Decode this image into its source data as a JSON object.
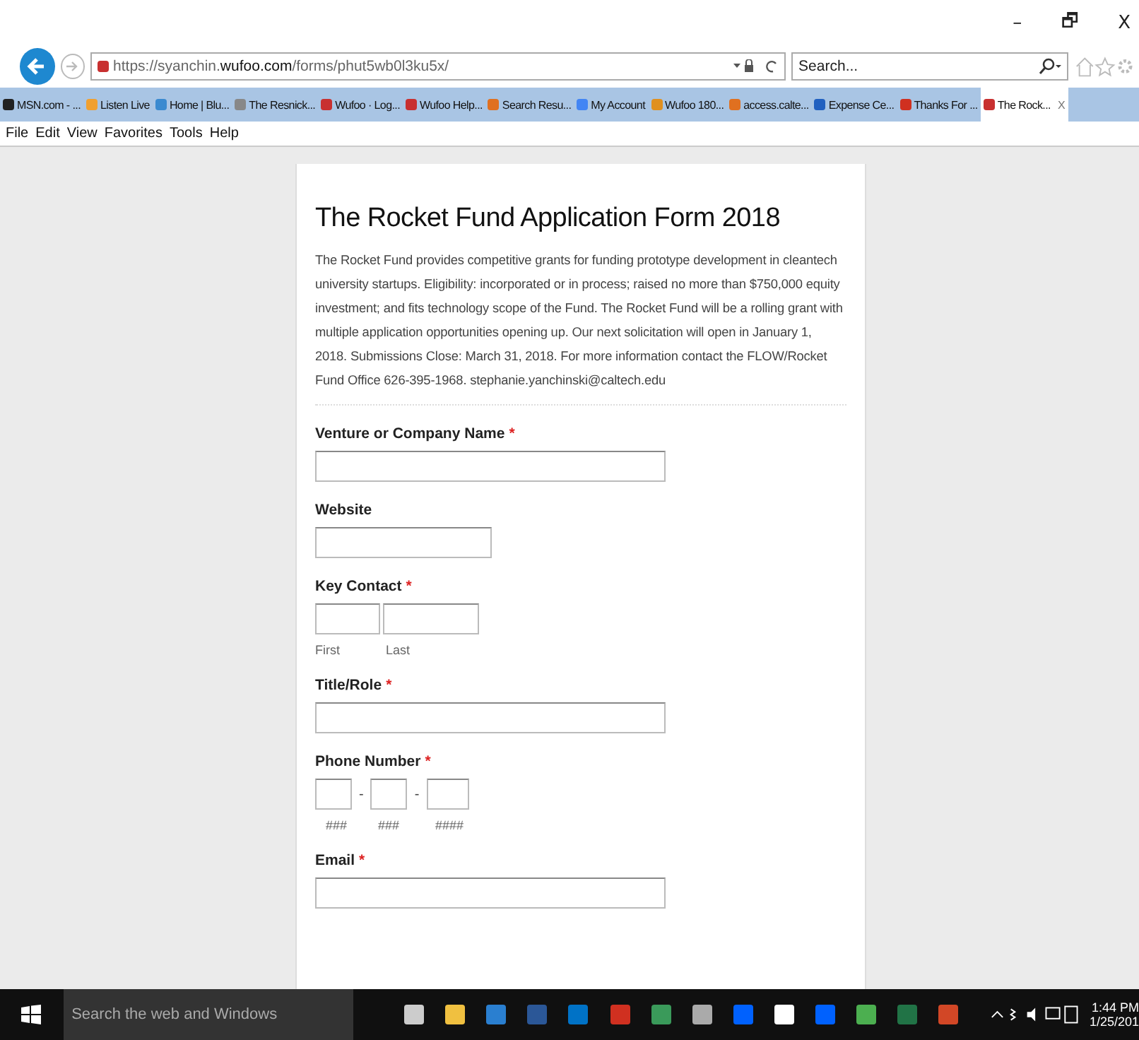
{
  "window": {
    "controls": [
      "–",
      "🗗",
      "X"
    ]
  },
  "address_bar": {
    "url_host_prefix": "https://syanchin.",
    "url_domain": "wufoo.com",
    "url_path": "/forms/phut5wb0l3ku5x/",
    "search_placeholder": "Search..."
  },
  "favorites_tabs": [
    {
      "label": "MSN.com - ...",
      "selected": false,
      "color": "#222222"
    },
    {
      "label": "Listen Live",
      "selected": false,
      "color": "#f0a030"
    },
    {
      "label": "Home | Blu...",
      "selected": false,
      "color": "#3a8ad0"
    },
    {
      "label": "The Resnick...",
      "selected": false,
      "color": "#888888"
    },
    {
      "label": "Wufoo · Log...",
      "selected": false,
      "color": "#c83030"
    },
    {
      "label": "Wufoo Help...",
      "selected": false,
      "color": "#c83030"
    },
    {
      "label": "Search Resu...",
      "selected": false,
      "color": "#e07020"
    },
    {
      "label": "My Account",
      "selected": false,
      "color": "#4285f4"
    },
    {
      "label": "Wufoo 180...",
      "selected": false,
      "color": "#e09020"
    },
    {
      "label": "access.calte...",
      "selected": false,
      "color": "#e07020"
    },
    {
      "label": "Expense Ce...",
      "selected": false,
      "color": "#2060c0"
    },
    {
      "label": "Thanks For ...",
      "selected": false,
      "color": "#d03020"
    },
    {
      "label": "The Rock...",
      "selected": true,
      "color": "#c83030"
    }
  ],
  "tab_close": "X",
  "menu": [
    "File",
    "Edit",
    "View",
    "Favorites",
    "Tools",
    "Help"
  ],
  "form": {
    "title": "The Rocket Fund Application Form 2018",
    "description": "The Rocket Fund provides competitive grants for funding prototype development in cleantech university startups. Eligibility: incorporated or in process; raised no more than $750,000 equity investment; and fits technology scope of the Fund. The Rocket Fund will be a rolling grant with multiple application opportunities opening up. Our next solicitation will open in January 1, 2018. Submissions Close: March 31, 2018. For more information contact the FLOW/Rocket Fund Office 626-395-1968. stephanie.yanchinski@caltech.edu",
    "required_marker": "*",
    "fields": [
      {
        "kind": "text",
        "label": "Venture or Company Name",
        "required": true
      },
      {
        "kind": "url",
        "label": "Website",
        "required": false
      },
      {
        "kind": "name",
        "label": "Key Contact",
        "required": true,
        "sublabels": [
          "First",
          "Last"
        ]
      },
      {
        "kind": "text",
        "label": "Title/Role",
        "required": true
      },
      {
        "kind": "phone",
        "label": "Phone Number",
        "required": true,
        "separator": "-",
        "sublabels": [
          "###",
          "###",
          "####"
        ]
      },
      {
        "kind": "text",
        "label": "Email",
        "required": true
      }
    ]
  },
  "taskbar": {
    "search_placeholder": "Search the web and Windows",
    "time": "1:44 PM",
    "date": "1/25/201"
  }
}
